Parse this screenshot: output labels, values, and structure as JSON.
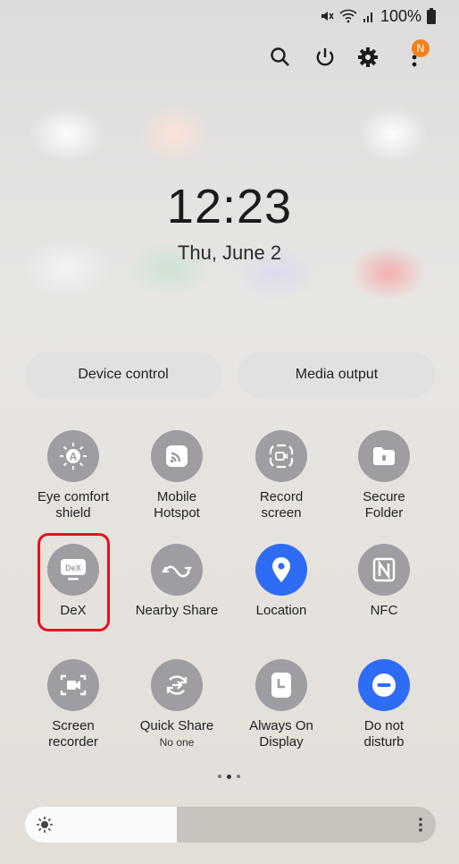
{
  "status_bar": {
    "battery": "100%"
  },
  "header_icons": [
    "search-icon",
    "power-icon",
    "settings-icon",
    "more-icon"
  ],
  "notification_badge": "N",
  "clock": {
    "time": "12:23",
    "date": "Thu, June 2"
  },
  "pills": {
    "device_control": "Device control",
    "media_output": "Media output"
  },
  "tiles": [
    {
      "label": "Eye comfort",
      "label2": "shield",
      "icon": "eye-comfort-icon"
    },
    {
      "label": "Mobile",
      "label2": "Hotspot",
      "icon": "hotspot-icon"
    },
    {
      "label": "Record",
      "label2": "screen",
      "icon": "record-screen-icon"
    },
    {
      "label": "Secure",
      "label2": "Folder",
      "icon": "secure-folder-icon"
    },
    {
      "label": "DeX",
      "icon": "dex-icon",
      "icon_text": "DeX"
    },
    {
      "label": "Nearby Share",
      "icon": "nearby-share-icon"
    },
    {
      "label": "Location",
      "icon": "location-icon",
      "active": true
    },
    {
      "label": "NFC",
      "icon": "nfc-icon"
    },
    {
      "label": "Screen",
      "label2": "recorder",
      "icon": "screen-recorder-icon"
    },
    {
      "label": "Quick Share",
      "sub": "No one",
      "icon": "quick-share-icon"
    },
    {
      "label": "Always On",
      "label2": "Display",
      "icon": "always-on-display-icon"
    },
    {
      "label": "Do not",
      "label2": "disturb",
      "icon": "do-not-disturb-icon",
      "active": true
    }
  ],
  "brightness": {
    "level": 0.37
  },
  "colors": {
    "active_tile": "#2f6cf6",
    "inactive_tile": "#9e9ea2",
    "badge": "#f2821f",
    "highlight": "#e3131b"
  }
}
